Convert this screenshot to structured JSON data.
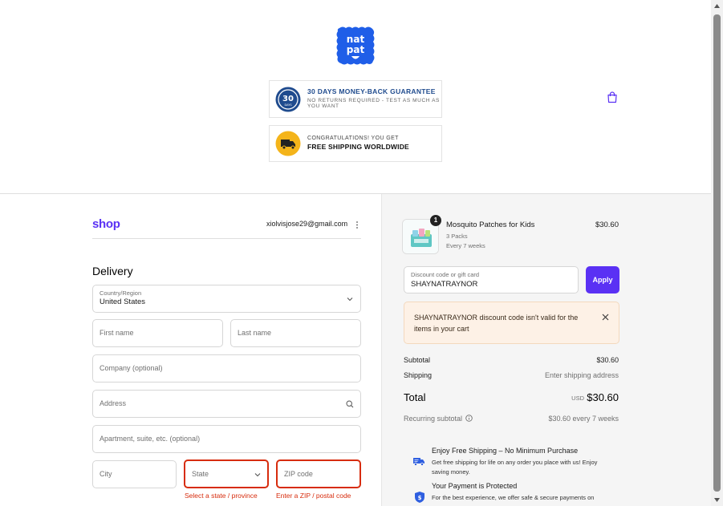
{
  "header": {
    "guarantee_title": "30 DAYS MONEY-BACK GUARANTEE",
    "guarantee_sub": "NO RETURNS REQUIRED - TEST AS MUCH AS YOU WANT",
    "guarantee_seal_number": "30",
    "guarantee_seal_text": "DAYS",
    "shipping_top": "CONGRATULATIONS! YOU GET",
    "shipping_main": "FREE SHIPPING WORLDWIDE"
  },
  "brand": {
    "logo_line1": "nat",
    "logo_line2": "pat",
    "logo_color": "#1f5ee8"
  },
  "account": {
    "shop_label": "shop",
    "email": "xiolvisjose29@gmail.com"
  },
  "delivery": {
    "heading": "Delivery",
    "country_label": "Country/Region",
    "country_value": "United States",
    "first_name_placeholder": "First name",
    "last_name_placeholder": "Last name",
    "company_placeholder": "Company (optional)",
    "address_placeholder": "Address",
    "apartment_placeholder": "Apartment, suite, etc. (optional)",
    "city_placeholder": "City",
    "state_placeholder": "State",
    "zip_placeholder": "ZIP code",
    "state_error": "Select a state / province",
    "zip_error": "Enter a ZIP / postal code"
  },
  "order": {
    "product_name": "Mosquito Patches for Kids",
    "product_variant": "3 Packs",
    "product_frequency": "Every 7 weeks",
    "product_price": "$30.60",
    "quantity": "1",
    "discount_label": "Discount code or gift card",
    "discount_value": "SHAYNATRAYNOR",
    "apply_label": "Apply",
    "alert_message": "SHAYNATRAYNOR discount code isn't valid for the items in your cart",
    "subtotal_label": "Subtotal",
    "subtotal_value": "$30.60",
    "shipping_label": "Shipping",
    "shipping_value": "Enter shipping address",
    "total_label": "Total",
    "total_currency": "USD",
    "total_value": "$30.60",
    "recurring_label": "Recurring subtotal",
    "recurring_value": "$30.60 every 7 weeks"
  },
  "perks": [
    {
      "title": "Enjoy Free Shipping – No Minimum Purchase",
      "desc": "Get free shipping for life on any order you place with us! Enjoy saving money."
    },
    {
      "title": "Your Payment is Protected",
      "desc": "For the best experience, we offer safe & secure payments on"
    }
  ],
  "colors": {
    "accent": "#5a31f4",
    "error": "#d72c0d",
    "brand_blue": "#1f5ee8",
    "alert_bg": "#fdf1e6"
  }
}
